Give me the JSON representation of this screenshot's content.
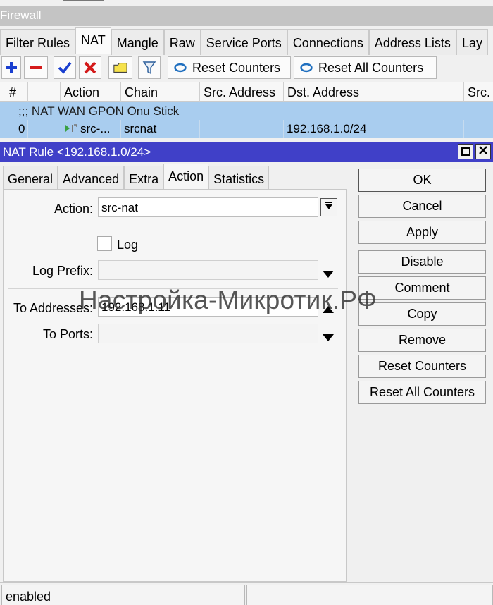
{
  "window": {
    "title": "Firewall"
  },
  "tabs": [
    "Filter Rules",
    "NAT",
    "Mangle",
    "Raw",
    "Service Ports",
    "Connections",
    "Address Lists",
    "Lay"
  ],
  "toolbar": {
    "reset_counters": "Reset Counters",
    "reset_all_counters": "Reset All Counters"
  },
  "columns": {
    "num": "#",
    "action": "Action",
    "chain": "Chain",
    "src": "Src. Address",
    "dst": "Dst. Address",
    "src2": "Src."
  },
  "list": {
    "comment": ";;; NAT WAN GPON Onu Stick",
    "row": {
      "num": "0",
      "action": "src-...",
      "chain": "srcnat",
      "dst": "192.168.1.0/24"
    }
  },
  "dialog": {
    "title": "NAT Rule <192.168.1.0/24>",
    "tabs": [
      "General",
      "Advanced",
      "Extra",
      "Action",
      "Statistics"
    ],
    "action_label": "Action:",
    "action_value": "src-nat",
    "log_label": "Log",
    "log_checked": false,
    "log_prefix_label": "Log Prefix:",
    "log_prefix_value": "",
    "to_addresses_label": "To Addresses:",
    "to_addresses_value": "192.168.1.11",
    "to_ports_label": "To Ports:",
    "to_ports_value": "",
    "buttons": [
      "OK",
      "Cancel",
      "Apply",
      "Disable",
      "Comment",
      "Copy",
      "Remove",
      "Reset Counters",
      "Reset All Counters"
    ]
  },
  "watermark": "Настройка-Микротик.РФ",
  "status": {
    "text": "enabled"
  },
  "colors": {
    "dialog_titlebar": "#4040c8",
    "selected_row": "#a9cdef",
    "titlebar": "#c4c4c4"
  }
}
